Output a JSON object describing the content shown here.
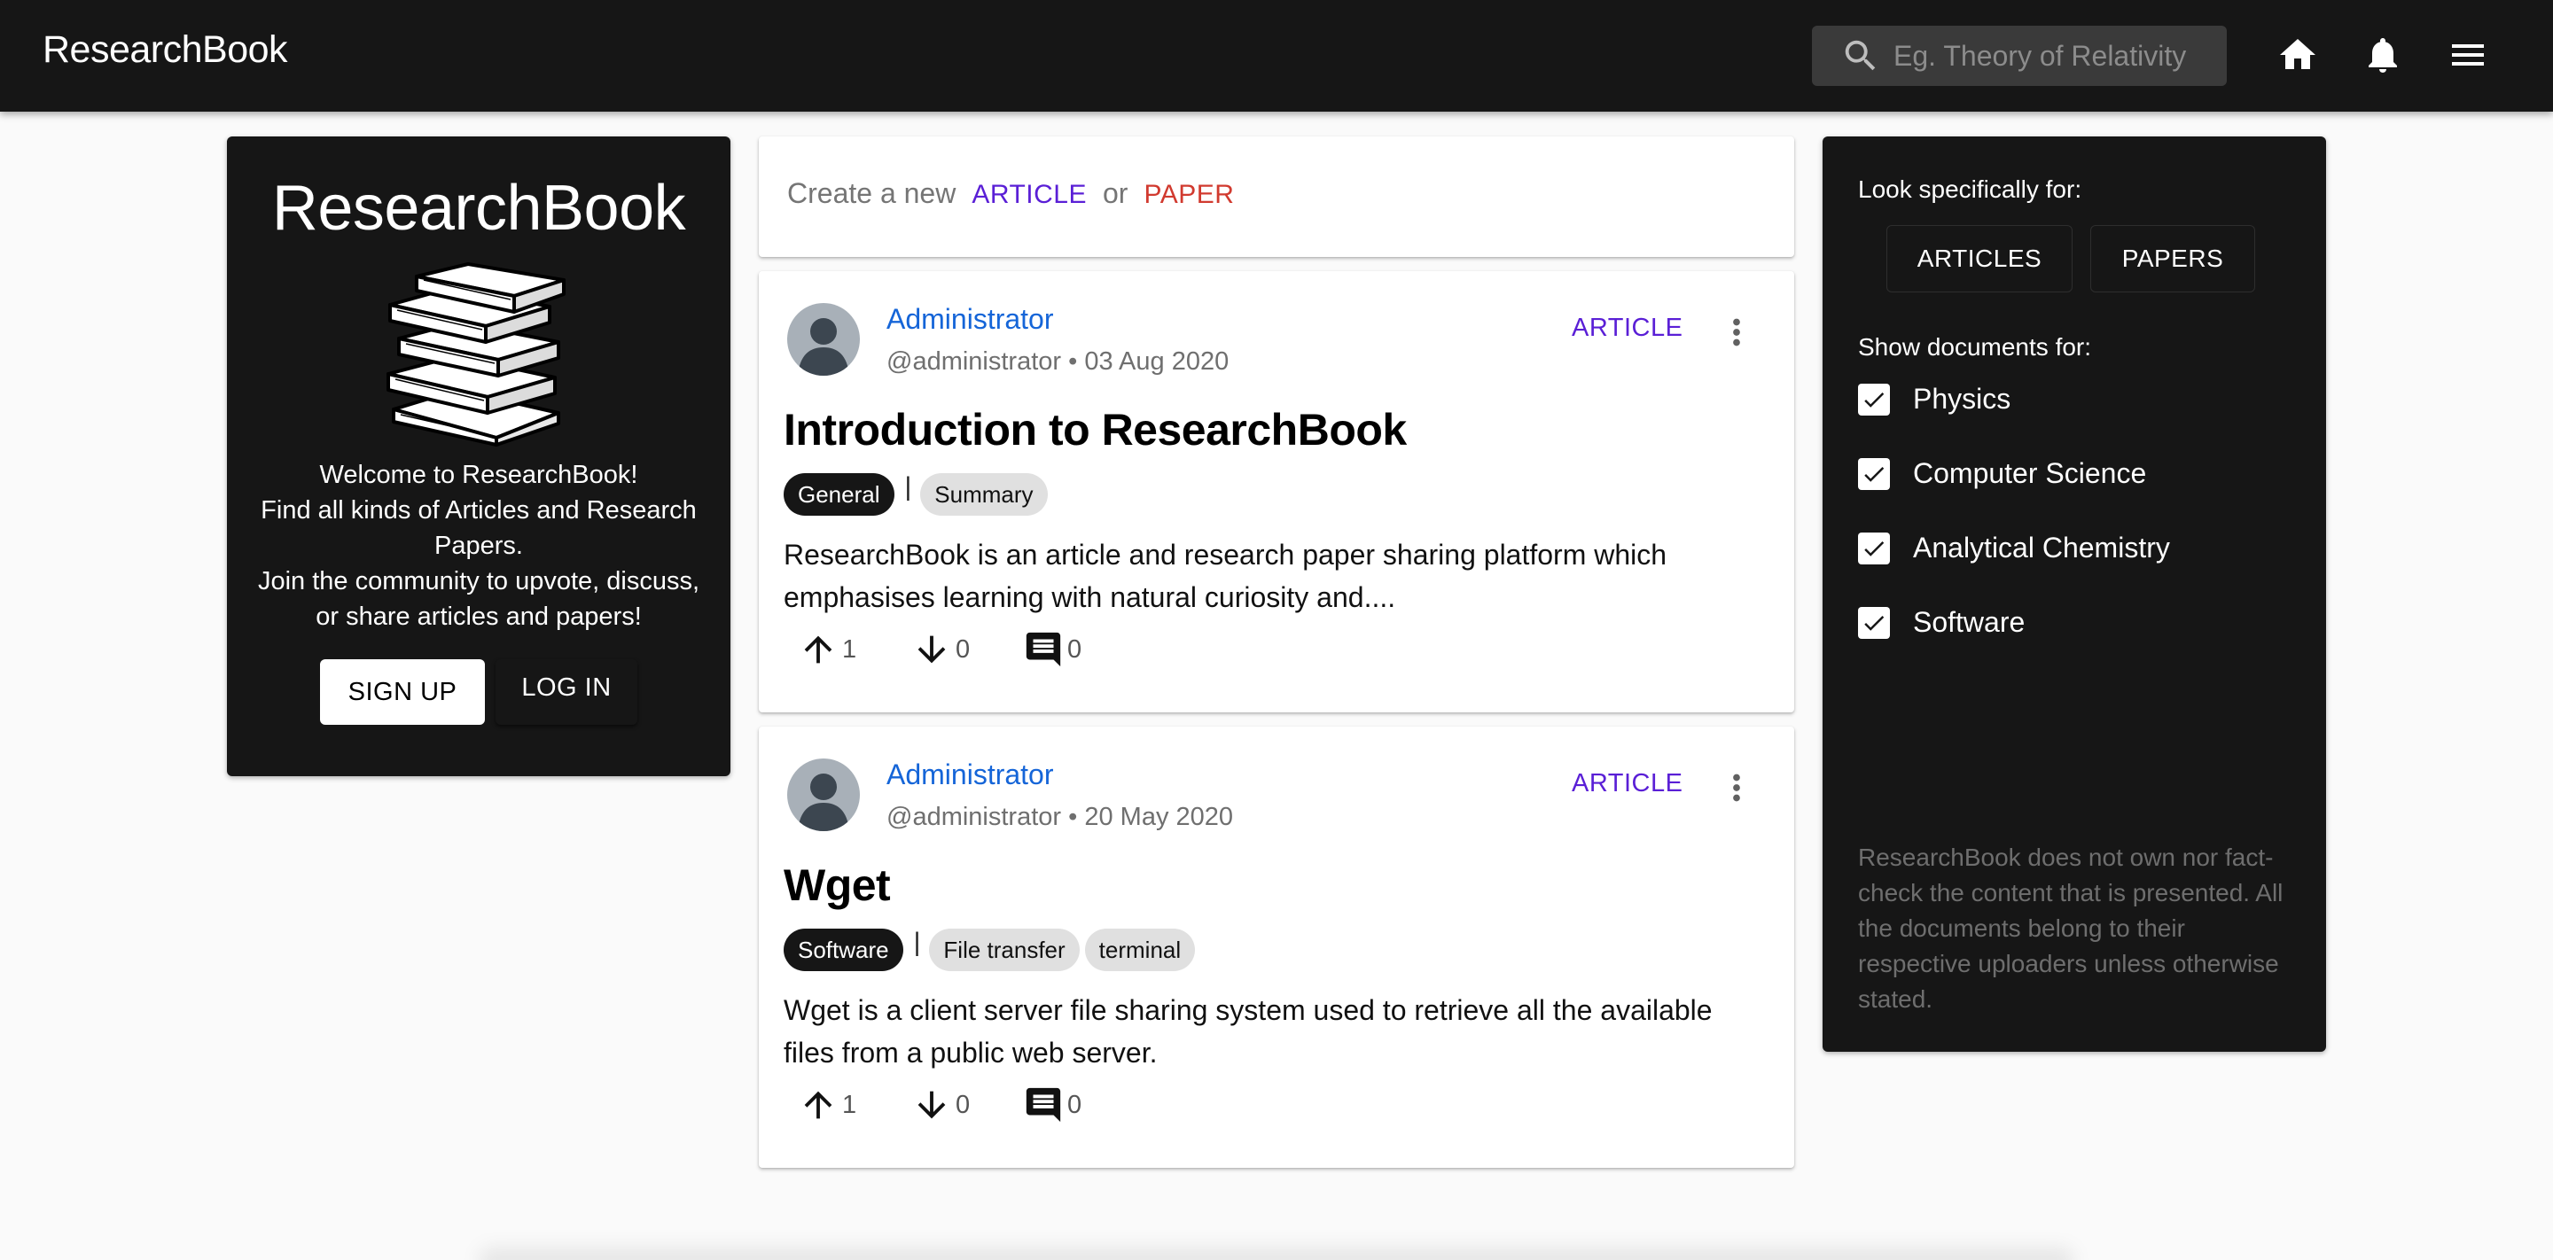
{
  "app": {
    "brand": "ResearchBook",
    "search_placeholder": "Eg. Theory of Relativity"
  },
  "left_card": {
    "title": "ResearchBook",
    "welcome_lines": [
      "Welcome to ResearchBook!",
      "Find all kinds of Articles and Research Papers.",
      "Join the community to upvote, discuss, or share articles and papers!"
    ],
    "signup_label": "SIGN UP",
    "login_label": "LOG IN"
  },
  "create": {
    "prefix": "Create a new",
    "article": "ARTICLE",
    "or": "or",
    "paper": "PAPER"
  },
  "posts": [
    {
      "author": "Administrator",
      "handle": "@administrator",
      "date": "03 Aug 2020",
      "type": "ARTICLE",
      "title": "Introduction to ResearchBook",
      "main_tag": "General",
      "tags": [
        "Summary"
      ],
      "description": "ResearchBook is an article and research paper sharing platform which emphasises learning with natural curiosity and....",
      "upvotes": "1",
      "downvotes": "0",
      "comments": "0"
    },
    {
      "author": "Administrator",
      "handle": "@administrator",
      "date": "20 May 2020",
      "type": "ARTICLE",
      "title": "Wget",
      "main_tag": "Software",
      "tags": [
        "File transfer",
        "terminal"
      ],
      "description": "Wget is a client server file sharing system used to retrieve all the available files from a public web server.",
      "upvotes": "1",
      "downvotes": "0",
      "comments": "0"
    }
  ],
  "right_card": {
    "look_for_label": "Look specifically for:",
    "articles_button": "ARTICLES",
    "papers_button": "PAPERS",
    "show_for_label": "Show documents for:",
    "categories": [
      {
        "label": "Physics",
        "checked": true
      },
      {
        "label": "Computer Science",
        "checked": true
      },
      {
        "label": "Analytical Chemistry",
        "checked": true
      },
      {
        "label": "Software",
        "checked": true
      }
    ],
    "disclaimer": "ResearchBook does not own nor fact-check the content that is presented. All the documents belong to their respective uploaders unless otherwise stated."
  },
  "colors": {
    "topbar": "#161616",
    "link_blue": "#1565d8",
    "article_purple": "#5a1fd6",
    "paper_red": "#d13a2f"
  }
}
